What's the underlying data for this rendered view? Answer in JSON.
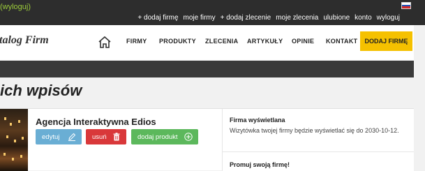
{
  "topbar": {
    "logout_label": "(wyloguj)",
    "links": [
      "+ dodaj firmę",
      "moje firmy",
      "+ dodaj zlecenie",
      "moje zlecenia",
      "ulubione",
      "konto",
      "wyloguj"
    ],
    "flag_colors": [
      "#ffffff",
      "#1f4fb5",
      "#d42a2a"
    ]
  },
  "navbar": {
    "brand": "talog Firm",
    "home_icon": "home-icon",
    "items": [
      "FIRMY",
      "PRODUKTY",
      "ZLECENIA",
      "ARTYKUŁY",
      "OPINIE",
      "KONTAKT"
    ],
    "cta": "DODAJ FIRMĘ",
    "cta_color": "#f5c100"
  },
  "page": {
    "title": "ich wpisów"
  },
  "listing": {
    "name": "Agencja Interaktywna Edios",
    "buttons": {
      "edit": "edytuj",
      "delete": "usuń",
      "add_product": "dodaj produkt"
    },
    "button_colors": {
      "edit": "#6aaed4",
      "delete": "#d9383a",
      "add_product": "#5cb85c"
    },
    "side": {
      "heading": "Firma wyświetlana",
      "text": "Wizytówka twojej firmy będzie wyświetlać się do 2030-10-12.",
      "promo_heading": "Promuj swoją firmę!"
    }
  }
}
